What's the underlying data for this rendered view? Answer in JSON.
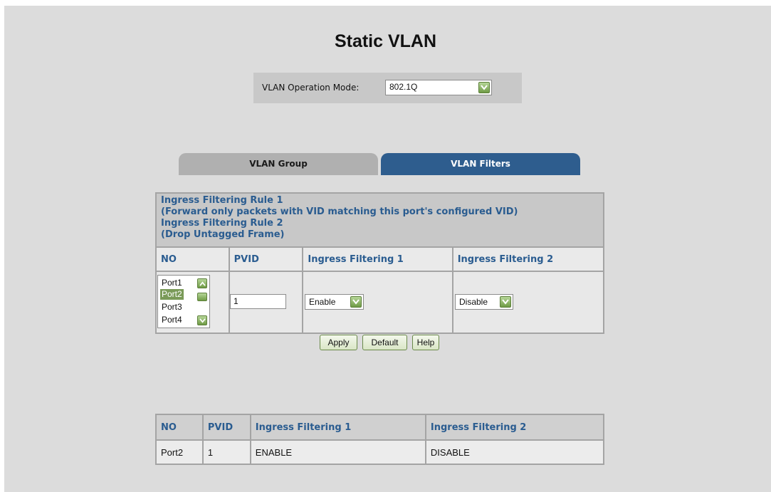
{
  "page": {
    "title": "Static VLAN"
  },
  "mode": {
    "label": "VLAN Operation Mode:",
    "value": "802.1Q"
  },
  "tabs": [
    {
      "label": "VLAN Group"
    },
    {
      "label": "VLAN Filters",
      "active": true
    }
  ],
  "rules": {
    "line1": "Ingress Filtering Rule 1",
    "line2": "(Forward only packets with VID matching this port's configured VID)",
    "line3": "Ingress Filtering Rule 2",
    "line4": "(Drop Untagged Frame)"
  },
  "form": {
    "headers": [
      "NO",
      "PVID",
      "Ingress Filtering 1",
      "Ingress Filtering 2"
    ],
    "ports": [
      "Port1",
      "Port2",
      "Port3",
      "Port4"
    ],
    "selected_port": "Port2",
    "pvid": "1",
    "filter1": "Enable",
    "filter2": "Disable"
  },
  "buttons": {
    "apply": "Apply",
    "default": "Default",
    "help": "Help"
  },
  "summary": {
    "headers": [
      "NO",
      "PVID",
      "Ingress Filtering 1",
      "Ingress Filtering 2"
    ],
    "rows": [
      [
        "Port2",
        "1",
        "ENABLE",
        "DISABLE"
      ]
    ]
  },
  "colors": {
    "tab_active": "#2e5d8e",
    "header_text": "#2a5c90",
    "button_green": "#6f9b45"
  }
}
